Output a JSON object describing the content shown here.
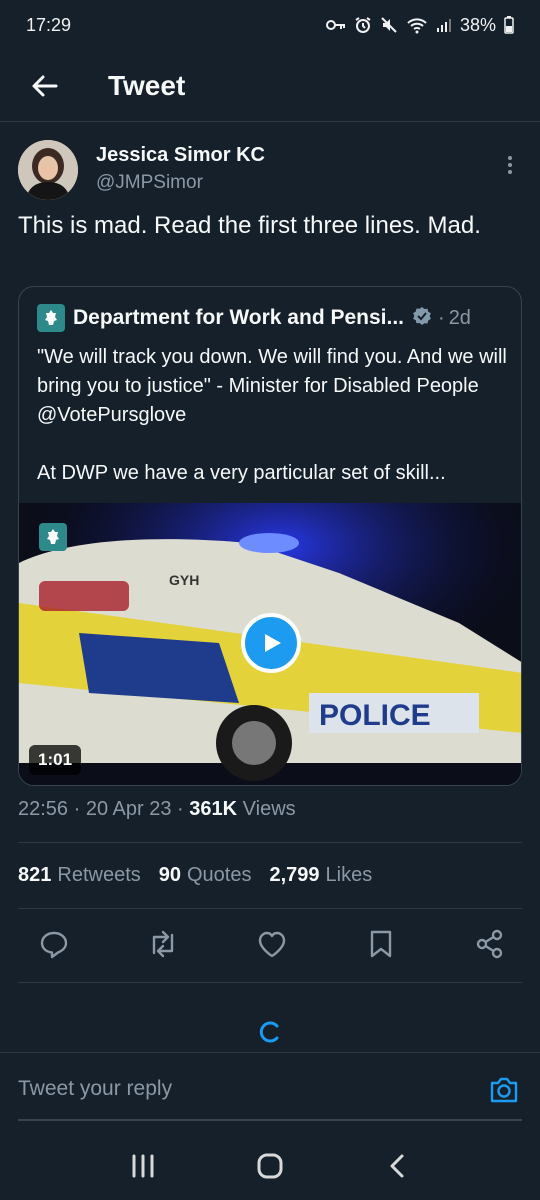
{
  "status_bar": {
    "time": "17:29",
    "battery": "38%"
  },
  "app_bar": {
    "title": "Tweet"
  },
  "tweet": {
    "author_name": "Jessica Simor KC",
    "author_handle": "@JMPSimor",
    "text": "This is mad.  Read the first three lines. Mad.",
    "quoted": {
      "author_name": "Department for Work and Pensi...",
      "separator": "·",
      "time": "2d",
      "lines": [
        "\"We will track you down. We will find you. And we will bring you to justice\" - Minister for Disabled People @VotePursglove",
        "At DWP we have a very particular set of skill..."
      ],
      "video_duration": "1:01",
      "video_text": {
        "car_label": "GYH",
        "car_text": "POLICE"
      }
    },
    "meta": {
      "time": "22:56",
      "date": "20 Apr 23",
      "views_count": "361K",
      "views_label": "Views",
      "sep": "·"
    },
    "stats": {
      "retweets_count": "821",
      "retweets_label": "Retweets",
      "quotes_count": "90",
      "quotes_label": "Quotes",
      "likes_count": "2,799",
      "likes_label": "Likes"
    },
    "actions": [
      "reply-icon",
      "retweet-icon",
      "like-icon",
      "bookmark-icon",
      "share-icon"
    ]
  },
  "reply": {
    "placeholder": "Tweet your reply"
  },
  "colors": {
    "background": "#15202b",
    "accent": "#1d9bf0",
    "muted": "#8b98a5"
  }
}
